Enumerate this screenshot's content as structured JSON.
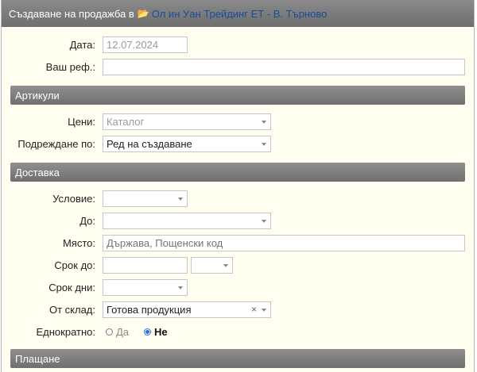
{
  "header": {
    "title_prefix": "Създаване на продажба в",
    "organization": "Ол ин Уан Трейдинг ЕТ - В. Търново"
  },
  "general": {
    "date_label": "Дата:",
    "date_value": "12.07.2024",
    "ref_label": "Ваш реф.:",
    "ref_value": ""
  },
  "articles": {
    "section_title": "Артикули",
    "prices_label": "Цени:",
    "prices_value": "Каталог",
    "order_label": "Подреждане по:",
    "order_value": "Ред на създаване"
  },
  "delivery": {
    "section_title": "Доставка",
    "condition_label": "Условие:",
    "condition_value": "",
    "to_label": "До:",
    "to_value": "",
    "place_label": "Място:",
    "place_placeholder": "Държава, Пощенски код",
    "deadline_label": "Срок до:",
    "deadline_date": "",
    "deadline_time": "",
    "days_label": "Срок дни:",
    "days_value": "",
    "warehouse_label": "От склад:",
    "warehouse_value": "Готова продукция",
    "warehouse_clear": "×",
    "onetime_label": "Еднократно:",
    "onetime_options": [
      "Да",
      "Не"
    ],
    "onetime_selected": "Не"
  },
  "payment": {
    "section_title": "Плащане"
  },
  "icons": {
    "folder": "folder-icon",
    "caret": "chevron-down-icon",
    "clear": "clear-icon"
  },
  "colors": {
    "header_bg": "#7a7a7a",
    "link": "#1a4d99",
    "panel_bg": "#fffef0",
    "radio_accent": "#2d6fd6"
  }
}
